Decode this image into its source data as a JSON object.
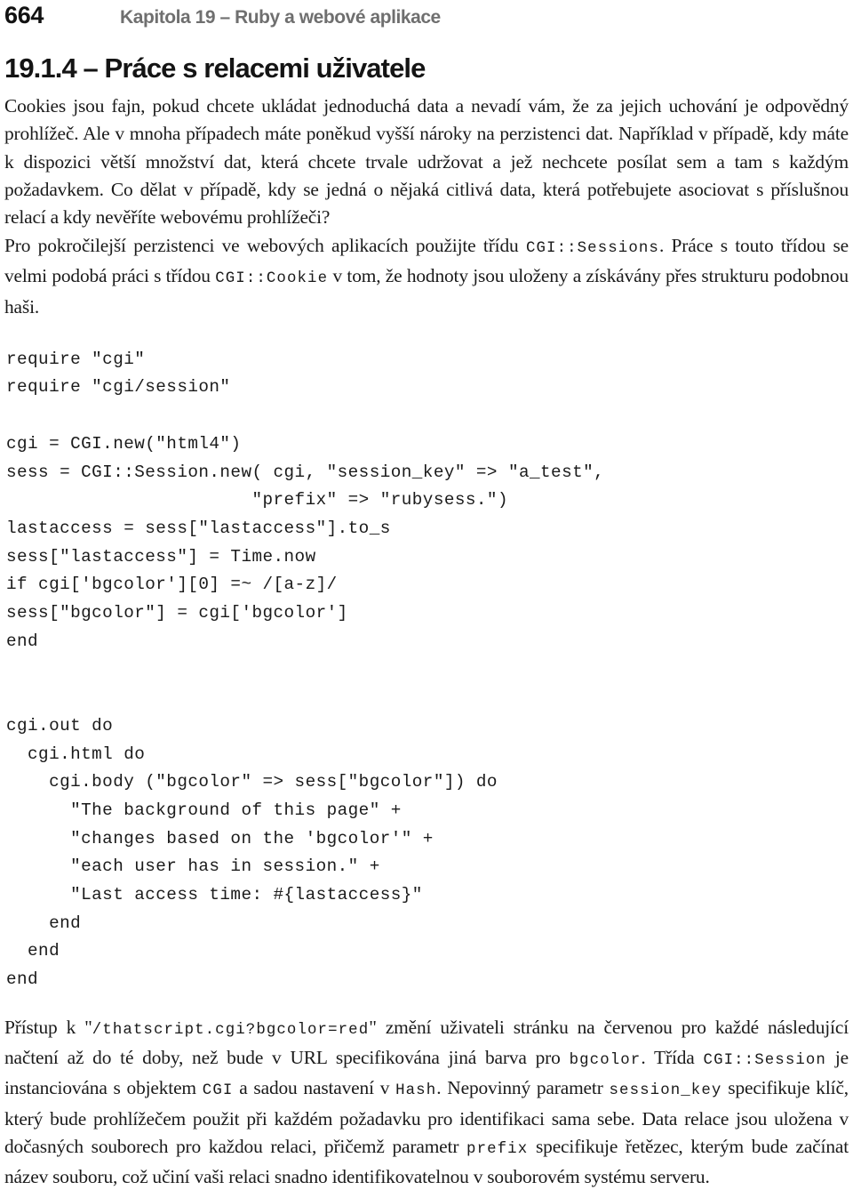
{
  "page": {
    "folio": "664",
    "running_head": "Kapitola 19 – Ruby a webové aplikace",
    "heading_color": "#141414",
    "running_head_color": "#6f6f6f",
    "background": "#ffffff"
  },
  "section": {
    "heading": "19.1.4 – Práce s relacemi uživatele"
  },
  "paragraphs": {
    "p1": "Cookies jsou fajn, pokud chcete ukládat jednoduchá data a nevadí vám, že za jejich uchování je odpovědný prohlížeč. Ale v mnoha případech máte poněkud vyšší nároky na perzistenci dat. Například v případě, kdy máte k dispozici větší množství dat, která chcete trvale udržovat a jež nechcete posílat sem a tam s každým požadavkem. Co dělat v případě, kdy se jedná o nějaká citlivá data, která potřebujete asociovat s příslušnou relací a kdy nevěříte webovému prohlížeči?",
    "p2_a": "Pro pokročilejší perzistenci ve webových aplikacích použijte třídu ",
    "p2_code1": "CGI::Sessions",
    "p2_b": ". Práce s touto třídou se velmi podobá práci s třídou ",
    "p2_code2": "CGI::Cookie",
    "p2_c": " v tom, že hodnoty jsou uloženy a získávány přes strukturu podobnou haši.",
    "p3_a": "Přístup k \"",
    "p3_code1": "/thatscript.cgi?bgcolor=red",
    "p3_b": "\" změní uživateli stránku na červenou pro každé následující načtení až do té doby, než bude v URL specifikována jiná barva pro ",
    "p3_code2": "bgcolor",
    "p3_c": ". Třída ",
    "p3_code3": "CGI::Session",
    "p3_d": " je instanciována s objektem ",
    "p3_code4": "CGI",
    "p3_e": " a sadou nastavení v ",
    "p3_code5": "Hash",
    "p3_f": ". Nepovinný parametr ",
    "p3_code6": "session_key",
    "p3_g": " specifikuje klíč, který bude prohlížečem použit při každém požadavku pro identifikaci sama sebe. Data relace jsou uložena v dočasných souborech pro každou relaci, přičemž parametr ",
    "p3_code7": "prefix",
    "p3_h": " specifikuje řetězec, kterým bude začínat název souboru, což učiní vaši relaci snadno identifikovatelnou v souborovém systému serveru."
  },
  "code_listing_1": {
    "language": "ruby",
    "text": "require \"cgi\"\nrequire \"cgi/session\"\n\ncgi = CGI.new(\"html4\")\nsess = CGI::Session.new( cgi, \"session_key\" => \"a_test\",\n                       \"prefix\" => \"rubysess.\")\nlastaccess = sess[\"lastaccess\"].to_s\nsess[\"lastaccess\"] = Time.now\nif cgi['bgcolor'][0] =~ /[a-z]/\nsess[\"bgcolor\"] = cgi['bgcolor']\nend\n\n\ncgi.out do\n  cgi.html do\n    cgi.body (\"bgcolor\" => sess[\"bgcolor\"]) do\n      \"The background of this page\" +\n      \"changes based on the 'bgcolor'\" +\n      \"each user has in session.\" +\n      \"Last access time: #{lastaccess}\"\n    end\n  end\nend"
  }
}
